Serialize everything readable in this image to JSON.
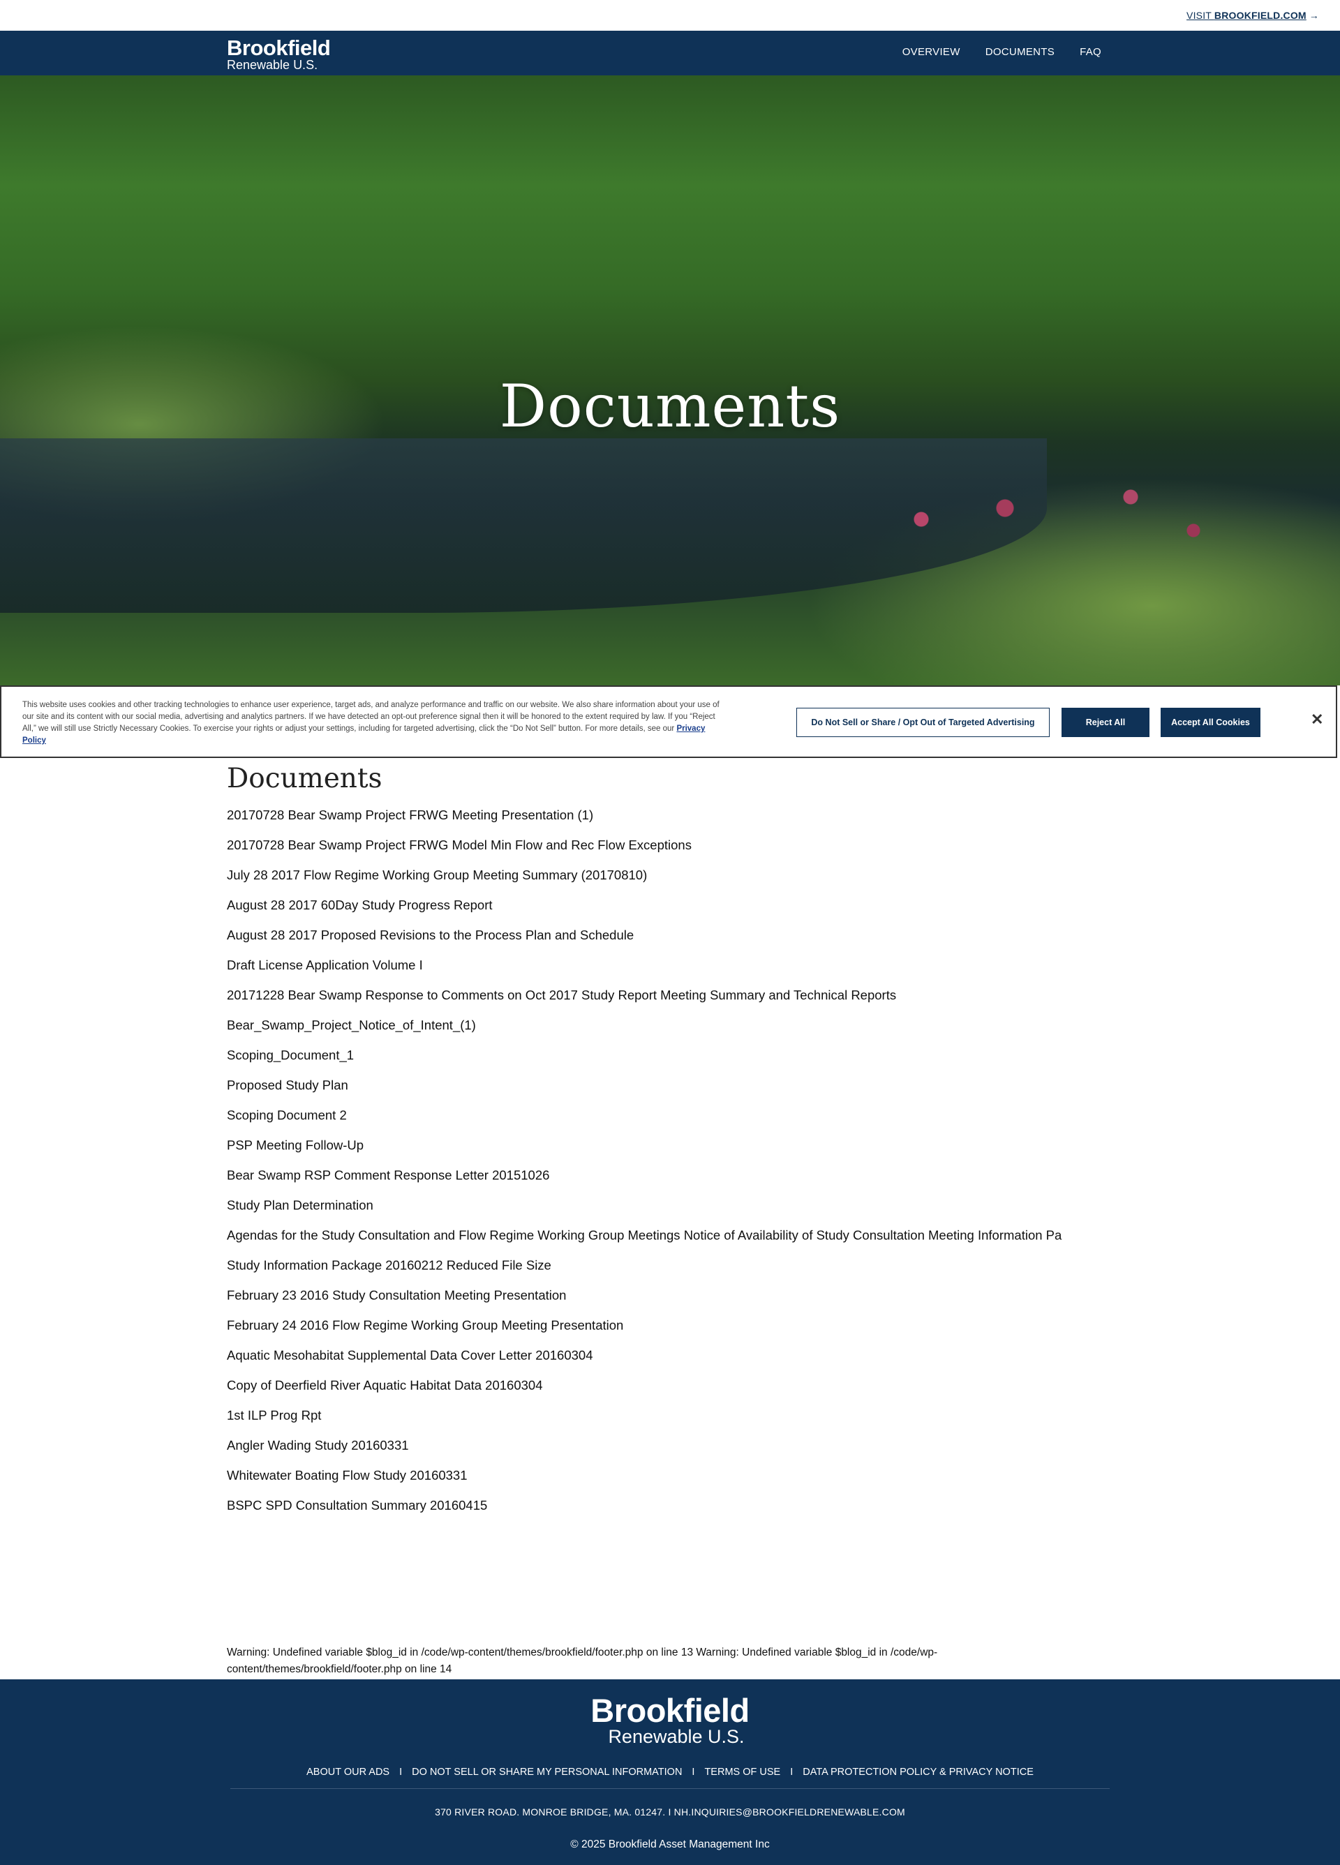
{
  "topbar": {
    "visit_prefix": "VISIT ",
    "visit_link": "BROOKFIELD.COM",
    "arrow_icon": "→"
  },
  "header": {
    "logo_line1": "Brookfield",
    "logo_line2": "Renewable U.S.",
    "nav": [
      "OVERVIEW",
      "DOCUMENTS",
      "FAQ"
    ]
  },
  "hero": {
    "title": "Documents"
  },
  "cookie": {
    "text": "This website uses cookies and other tracking technologies to enhance user experience, target ads, and analyze performance and traffic on our website. We also share information about your use of our site and its content with our social media, advertising and analytics partners. If we have detected an opt-out preference signal then it will be honored to the extent required by law. If you “Reject All,” we will still use Strictly Necessary Cookies. To exercise your rights or adjust your settings, including for targeted advertising, click the “Do Not Sell” button. For more details, see our",
    "privacy_link": "Privacy Policy",
    "do_not_sell_button": "Do Not Sell or Share / Opt Out of Targeted Advertising",
    "reject_button": "Reject All",
    "accept_button": "Accept All Cookies",
    "close_icon": "✕"
  },
  "documents": {
    "heading": "Documents",
    "items": [
      "20170728 Bear Swamp Project FRWG Meeting Presentation (1)",
      "20170728 Bear Swamp Project FRWG Model Min Flow and Rec Flow Exceptions",
      "July 28 2017 Flow Regime Working Group Meeting Summary (20170810)",
      "August 28 2017 60Day Study Progress Report",
      "August 28 2017 Proposed Revisions to the Process Plan and Schedule",
      "Draft License Application Volume I",
      "20171228 Bear Swamp Response to Comments on Oct 2017 Study Report Meeting Summary and Technical Reports",
      "Bear_Swamp_Project_Notice_of_Intent_(1)",
      "Scoping_Document_1",
      "Proposed Study Plan",
      "Scoping Document 2",
      "PSP Meeting Follow-Up",
      "Bear Swamp RSP Comment Response Letter 20151026",
      "Study Plan Determination",
      "Agendas for the Study Consultation and Flow Regime Working Group Meetings Notice of Availability of Study Consultation Meeting Information Pa",
      "Study Information Package 20160212 Reduced File Size",
      "February 23 2016 Study Consultation Meeting Presentation",
      "February 24 2016 Flow Regime Working Group Meeting Presentation",
      "Aquatic Mesohabitat Supplemental Data Cover Letter 20160304",
      "Copy of Deerfield River Aquatic Habitat Data 20160304",
      "1st ILP Prog Rpt",
      "Angler Wading Study 20160331",
      "Whitewater Boating Flow Study 20160331",
      "BSPC SPD Consultation Summary 20160415"
    ]
  },
  "warning": "Warning: Undefined variable $blog_id in /code/wp-content/themes/brookfield/footer.php on line 13 Warning: Undefined variable $blog_id in /code/wp-content/themes/brookfield/footer.php on line 14",
  "footer": {
    "logo_line1": "Brookfield",
    "logo_line2": "Renewable U.S.",
    "links": [
      "ABOUT OUR ADS",
      "DO NOT SELL OR SHARE MY PERSONAL INFORMATION",
      "TERMS OF USE",
      "DATA PROTECTION POLICY & PRIVACY NOTICE"
    ],
    "separator": "I",
    "address": "370 RIVER ROAD. MONROE BRIDGE, MA. 01247. I NH.INQUIRIES@BROOKFIELDRENEWABLE.COM",
    "copyright": "© 2025 Brookfield Asset Management Inc"
  },
  "colors": {
    "brand_navy": "#0f3257",
    "white": "#ffffff"
  }
}
